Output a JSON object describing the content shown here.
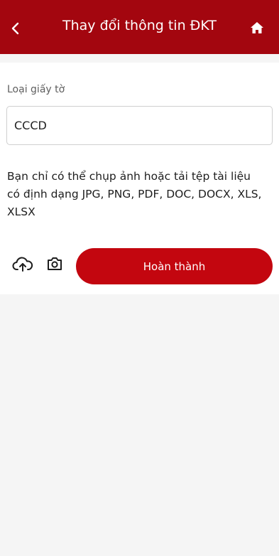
{
  "header": {
    "title": "Thay đổi thông tin ĐKT",
    "back_icon": "chevron-left-icon",
    "home_icon": "home-icon",
    "bg_color": "#a3060f"
  },
  "form": {
    "doc_type_label": "Loại giấy tờ",
    "doc_type_value": "CCCD",
    "note": "Bạn chỉ có thể chụp ảnh hoặc tải tệp tài liệu có định dạng JPG, PNG, PDF, DOC, DOCX, XLS, XLSX"
  },
  "actions": {
    "upload_icon": "cloud-upload-icon",
    "camera_icon": "camera-icon",
    "submit_label": "Hoàn thành",
    "accent_color": "#c3060f"
  }
}
